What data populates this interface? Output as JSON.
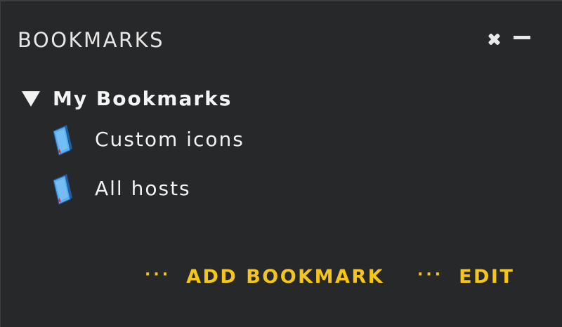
{
  "panel": {
    "title": "BOOKMARKS"
  },
  "window_controls": {
    "close_icon": "close-icon",
    "minimize_icon": "minimize-icon"
  },
  "tree": {
    "group": {
      "label": "My Bookmarks",
      "expanded": true,
      "icon": "caret-down-icon"
    },
    "items": [
      {
        "label": "Custom icons",
        "icon": "book-icon"
      },
      {
        "label": "All hosts",
        "icon": "book-icon"
      }
    ]
  },
  "actions": {
    "add": {
      "dots": "···",
      "label": "ADD BOOKMARK"
    },
    "edit": {
      "dots": "···",
      "label": "EDIT"
    }
  },
  "colors": {
    "background": "#26282a",
    "text": "#f2f2f2",
    "accent": "#f5c518",
    "book_blue": "#4fa3ea",
    "bookmark_ribbon": "#d7262b"
  }
}
